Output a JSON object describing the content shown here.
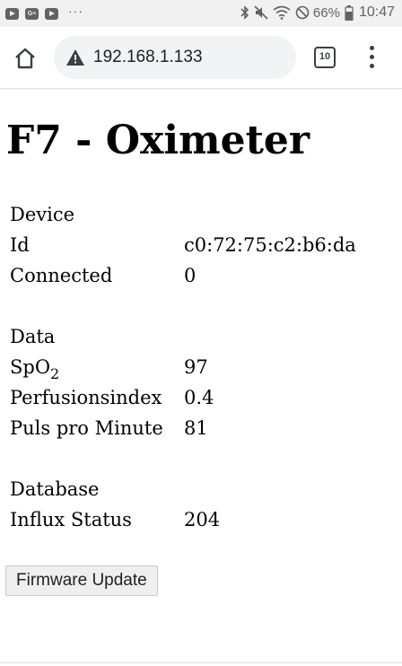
{
  "status_bar": {
    "left_icons": [
      "youtube-icon",
      "google-news-icon",
      "youtube-icon"
    ],
    "overflow": "···",
    "right_icons": [
      "bluetooth-icon",
      "mute-icon",
      "wifi-icon",
      "do-not-disturb-icon",
      "battery-icon"
    ],
    "battery": "66%",
    "time": "10:47"
  },
  "browser": {
    "url": "192.168.1.133",
    "tab_count": "10",
    "security_icon": "warning-icon"
  },
  "page": {
    "title": "F7 - Oximeter",
    "sections": {
      "device": {
        "heading": "Device",
        "id_label": "Id",
        "id_value": "c0:72:75:c2:b6:da",
        "connected_label": "Connected",
        "connected_value": "0"
      },
      "data": {
        "heading": "Data",
        "spo2_label": "SpO",
        "spo2_subscript": "2",
        "spo2_value": "97",
        "perfusion_label": "Perfusionsindex",
        "perfusion_value": "0.4",
        "pulse_label": "Puls pro Minute",
        "pulse_value": "81"
      },
      "database": {
        "heading": "Database",
        "influx_label": "Influx Status",
        "influx_value": "204"
      }
    },
    "firmware_button": "Firmware Update"
  },
  "colors": {
    "status_bar_bg": "#f1f1f1",
    "omnibox_bg": "#f1f3f4",
    "icon_color": "#3c4043"
  }
}
